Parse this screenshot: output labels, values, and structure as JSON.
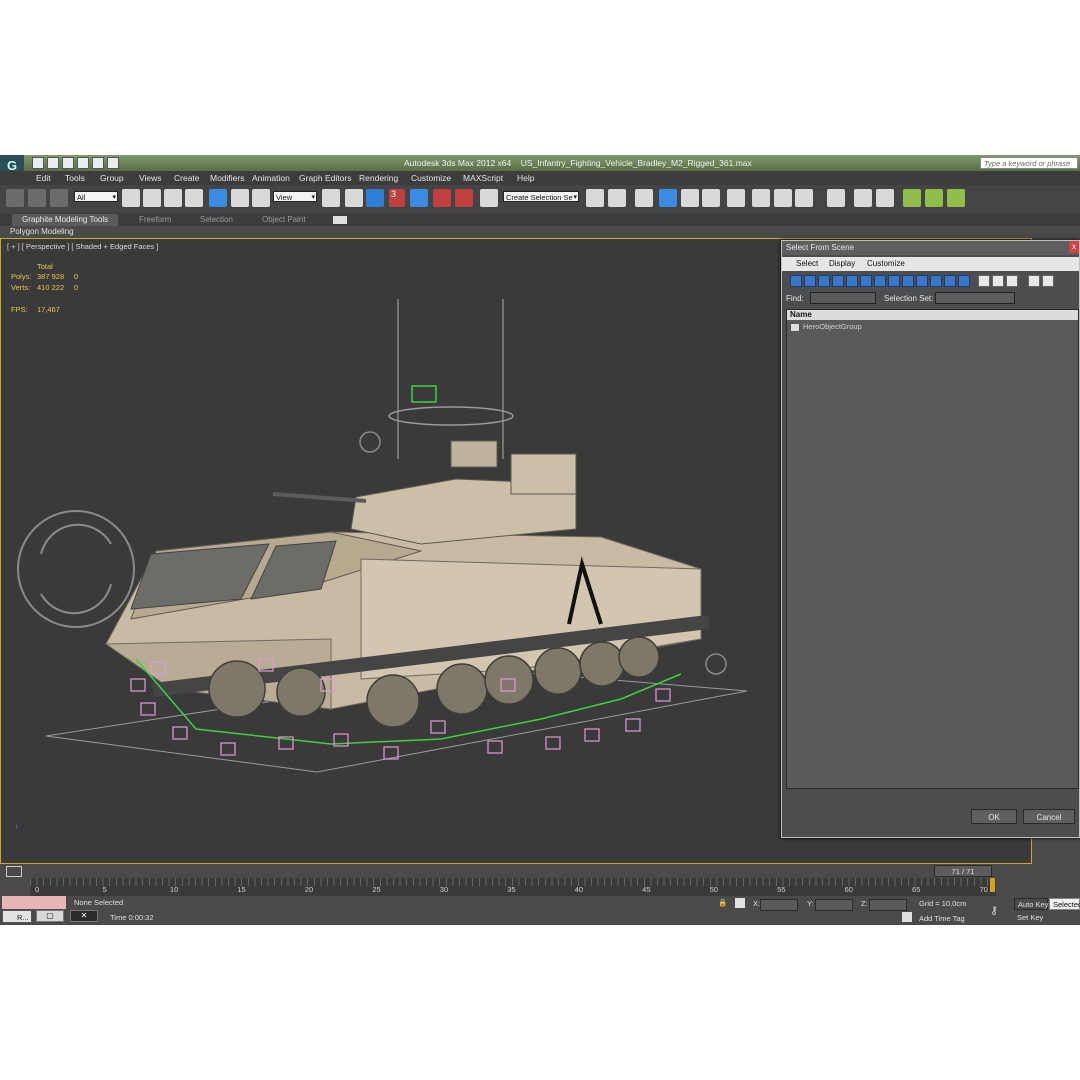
{
  "app": {
    "logo": "G",
    "title": "Autodesk 3ds Max  2012 x64",
    "filename": "US_Infantry_Fighting_Vehicle_Bradley_M2_Rigged_361.max",
    "help_search_placeholder": "Type a keyword or phrase"
  },
  "menu": [
    "Edit",
    "Tools",
    "Group",
    "Views",
    "Create",
    "Modifiers",
    "Animation",
    "Graph Editors",
    "Rendering",
    "Customize",
    "MAXScript",
    "Help"
  ],
  "toolbar": {
    "selection_filter": "All",
    "reference_coord": "View",
    "named_selection": "Create Selection Se",
    "angle_snap_label": "3"
  },
  "ribbon": {
    "tabs": [
      "Graphite Modeling Tools",
      "Freeform",
      "Selection",
      "Object Paint"
    ],
    "active_tab": "Graphite Modeling Tools",
    "panel": "Polygon Modeling"
  },
  "viewport": {
    "label": "[ + ] [ Perspective ] [ Shaded + Edged Faces ]",
    "stats": {
      "total_header": "Total",
      "polys_label": "Polys:",
      "polys_value": "387 928",
      "polys_sel": "0",
      "verts_label": "Verts:",
      "verts_value": "410 222",
      "verts_sel": "0",
      "fps_label": "FPS:",
      "fps_value": "17,467"
    }
  },
  "select_dialog": {
    "title": "Select From Scene",
    "close": "x",
    "menu": [
      "Select",
      "Display",
      "Customize"
    ],
    "find_label": "Find:",
    "selection_set_label": "Selection Set:",
    "column_header": "Name",
    "items": [
      "HeroObjectGroup"
    ],
    "ok": "OK",
    "cancel": "Cancel"
  },
  "timeline": {
    "frame_display": "71 / 71",
    "current_frame": 71,
    "total_frames": 71,
    "ticks": [
      "0",
      "5",
      "10",
      "15",
      "20",
      "25",
      "30",
      "35",
      "40",
      "45",
      "50",
      "55",
      "60",
      "65",
      "70"
    ]
  },
  "status": {
    "taskbar_label": "R...",
    "selection": "None Selected",
    "time": "Time  0:00:32",
    "x_label": "X:",
    "y_label": "Y:",
    "z_label": "Z:",
    "grid": "Grid = 10,0cm",
    "add_time_tag": "Add Time Tag",
    "auto_key": "Auto Key",
    "selected": "Selected",
    "set_key": "Set Key"
  },
  "colors": {
    "title_bar": "#6d8758",
    "viewport_bg": "#3a3a3a",
    "viewport_border": "#c9a834",
    "stats_text": "#e6c84a",
    "vehicle_tan": "#c9bba3",
    "bone_pink": "#e49ad6",
    "selection_green": "#3cd23c"
  }
}
